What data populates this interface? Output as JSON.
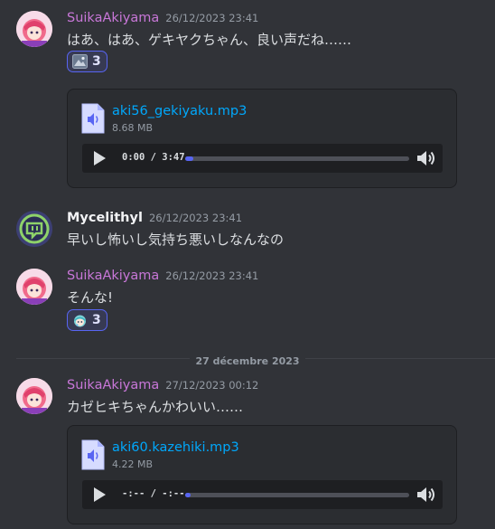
{
  "messages": [
    {
      "username": "SuikaAkiyama",
      "timestamp": "26/12/2023 23:41",
      "content": "はあ、はあ、ゲキヤクちゃん、良い声だね……",
      "reaction": {
        "emoji": "image-emoji",
        "count": "3"
      },
      "attachment": {
        "file_name": "aki56_gekiyaku.mp3",
        "file_size": "8.68 MB",
        "time": "0:00 / 3:47",
        "progress": 0.02
      }
    },
    {
      "username": "Mycelithyl",
      "timestamp": "26/12/2023 23:41",
      "content": "早いし怖いし気持ち悪いしなんなの"
    },
    {
      "username": "SuikaAkiyama",
      "timestamp": "26/12/2023 23:41",
      "content": "そんな!",
      "reaction": {
        "emoji": "crying-character-emoji",
        "count": "3"
      }
    },
    {
      "username": "SuikaAkiyama",
      "timestamp": "27/12/2023 00:12",
      "content": "カゼヒキちゃんかわいい……",
      "attachment": {
        "file_name": "aki60.kazehiki.mp3",
        "file_size": "4.22 MB",
        "time": "-:-- / -:--",
        "progress": 0.02
      }
    }
  ],
  "date_divider": "27 décembre 2023",
  "colors": {
    "background": "#313338",
    "username_suika": "#c877d8",
    "link": "#00a8fc",
    "accent": "#5865f2"
  }
}
